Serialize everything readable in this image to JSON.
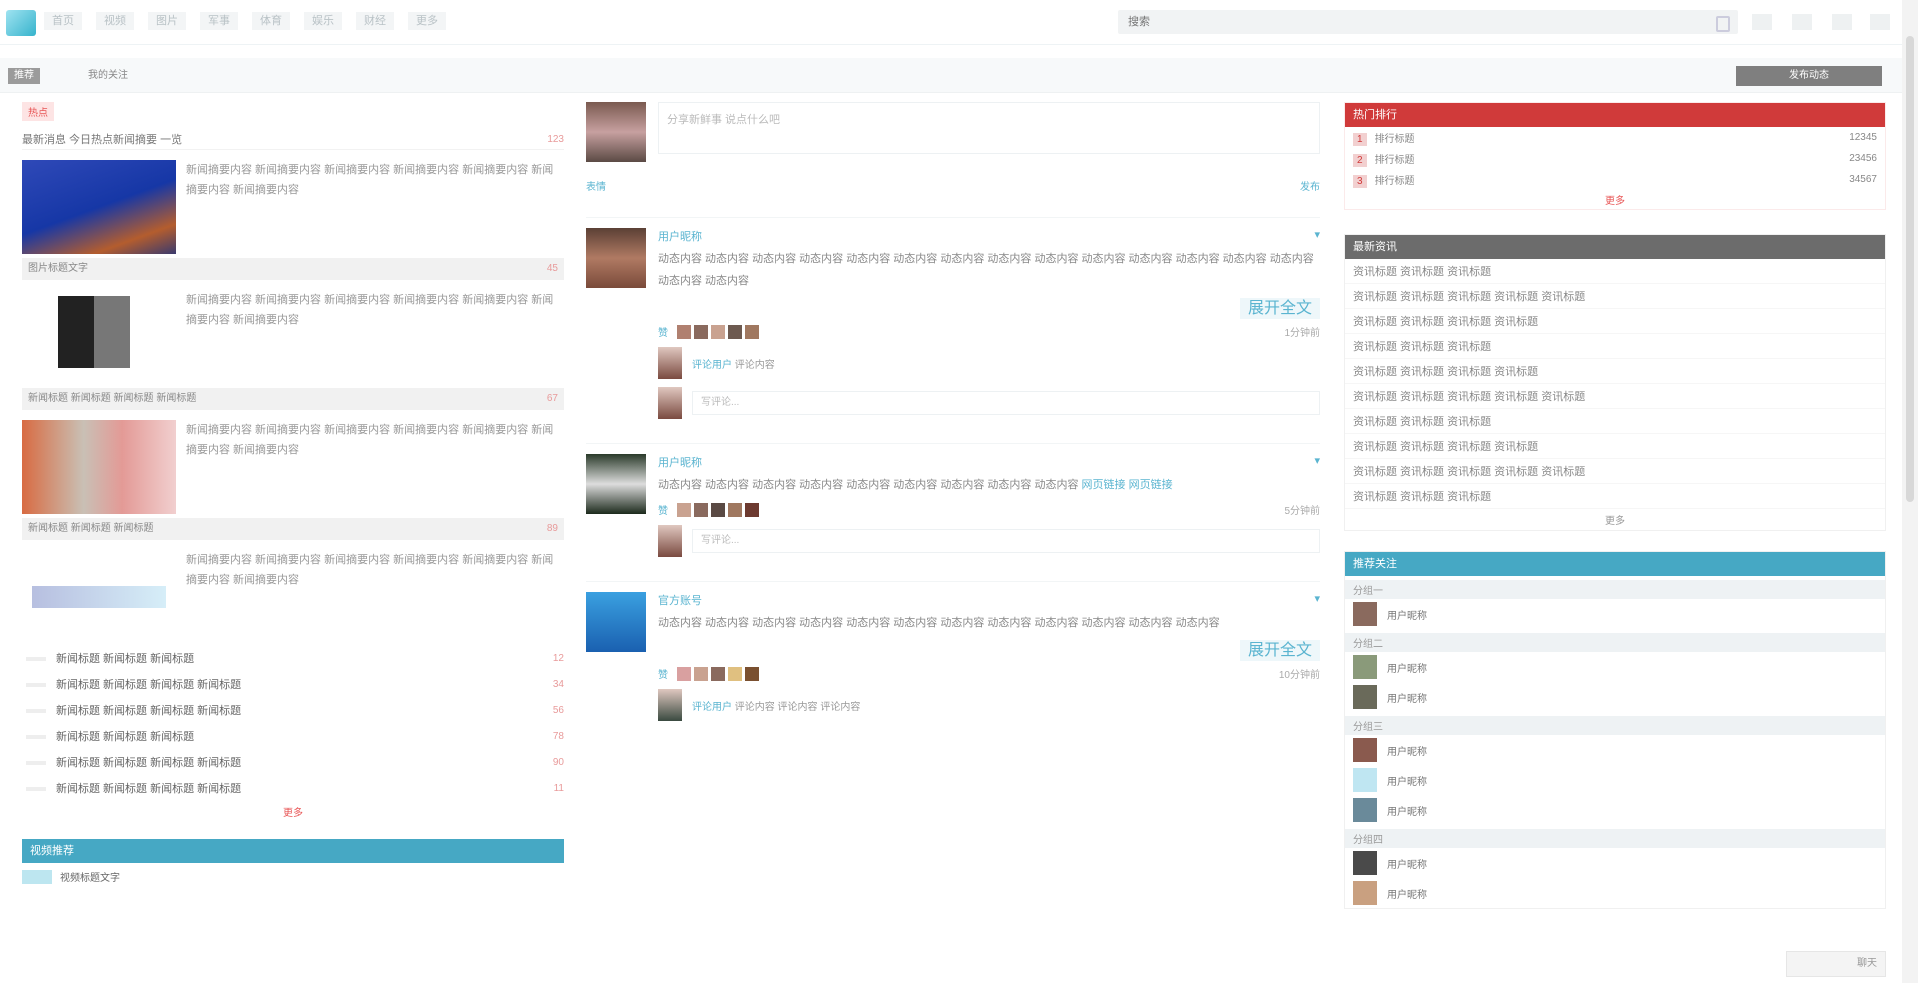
{
  "topbar": {
    "nav": [
      "首页",
      "视频",
      "图片",
      "军事",
      "体育",
      "娱乐",
      "财经",
      "更多"
    ],
    "search_placeholder": "搜索",
    "icons": [
      "home-icon",
      "bell-icon",
      "mail-icon",
      "user-icon"
    ]
  },
  "subbar": {
    "tabs": [
      "推荐",
      "我的关注"
    ],
    "right_button": "发布动态"
  },
  "left": {
    "section_tag": "热点",
    "headline": "最新消息 今日热点新闻摘要 一览",
    "headline_count": "123",
    "blocks": [
      {
        "text": "新闻摘要内容 新闻摘要内容 新闻摘要内容 新闻摘要内容 新闻摘要内容 新闻摘要内容 新闻摘要内容",
        "caption": "图片标题文字",
        "count": "45"
      },
      {
        "text": "新闻摘要内容 新闻摘要内容 新闻摘要内容 新闻摘要内容 新闻摘要内容 新闻摘要内容 新闻摘要内容",
        "caption": "新闻标题 新闻标题 新闻标题 新闻标题",
        "count": "67"
      },
      {
        "text": "新闻摘要内容 新闻摘要内容 新闻摘要内容 新闻摘要内容 新闻摘要内容 新闻摘要内容 新闻摘要内容",
        "caption": "新闻标题 新闻标题 新闻标题",
        "count": "89"
      },
      {
        "text": "新闻摘要内容 新闻摘要内容 新闻摘要内容 新闻摘要内容 新闻摘要内容 新闻摘要内容 新闻摘要内容",
        "caption": "",
        "count": ""
      }
    ],
    "list": [
      {
        "title": "新闻标题 新闻标题 新闻标题",
        "count": "12"
      },
      {
        "title": "新闻标题 新闻标题 新闻标题 新闻标题",
        "count": "34"
      },
      {
        "title": "新闻标题 新闻标题 新闻标题 新闻标题",
        "count": "56"
      },
      {
        "title": "新闻标题 新闻标题 新闻标题",
        "count": "78"
      },
      {
        "title": "新闻标题 新闻标题 新闻标题 新闻标题",
        "count": "90"
      },
      {
        "title": "新闻标题 新闻标题 新闻标题 新闻标题",
        "count": "11"
      }
    ],
    "more": "更多",
    "blue_section": "视频推荐",
    "blue_item": "视频标题文字"
  },
  "mid": {
    "composer_placeholder": "分享新鲜事 说点什么吧",
    "composer_left": "表情",
    "composer_right": "发布",
    "posts": [
      {
        "name": "用户昵称",
        "text": "动态内容 动态内容 动态内容 动态内容 动态内容 动态内容 动态内容 动态内容 动态内容 动态内容 动态内容 动态内容 动态内容 动态内容 动态内容 动态内容",
        "link": "",
        "likes_label": "赞",
        "time": "1分钟前",
        "expand": "展开全文",
        "comment_name": "评论用户",
        "comment_text": "评论内容",
        "comment_placeholder": "写评论..."
      },
      {
        "name": "用户昵称",
        "text": "动态内容 动态内容 动态内容 动态内容 动态内容 动态内容 动态内容 动态内容 动态内容",
        "link": "网页链接 网页链接",
        "likes_label": "赞",
        "time": "5分钟前",
        "expand": "",
        "comment_name": "",
        "comment_text": "",
        "comment_placeholder": "写评论..."
      },
      {
        "name": "官方账号",
        "text": "动态内容 动态内容 动态内容 动态内容 动态内容 动态内容 动态内容 动态内容 动态内容 动态内容 动态内容 动态内容",
        "link": "",
        "likes_label": "赞",
        "time": "10分钟前",
        "expand": "展开全文",
        "comment_name": "评论用户",
        "comment_text": "评论内容 评论内容 评论内容",
        "comment_placeholder": "写评论..."
      }
    ]
  },
  "right": {
    "red_head": "热门排行",
    "red_rows": [
      {
        "rank": "1",
        "title": "排行标题",
        "value": "12345"
      },
      {
        "rank": "2",
        "title": "排行标题",
        "value": "23456"
      },
      {
        "rank": "3",
        "title": "排行标题",
        "value": "34567"
      }
    ],
    "red_more": "更多",
    "gray_head": "最新资讯",
    "gray_rows": [
      "资讯标题 资讯标题 资讯标题",
      "资讯标题 资讯标题 资讯标题 资讯标题 资讯标题",
      "资讯标题 资讯标题 资讯标题 资讯标题",
      "资讯标题 资讯标题 资讯标题",
      "资讯标题 资讯标题 资讯标题 资讯标题",
      "资讯标题 资讯标题 资讯标题 资讯标题 资讯标题",
      "资讯标题 资讯标题 资讯标题",
      "资讯标题 资讯标题 资讯标题 资讯标题",
      "资讯标题 资讯标题 资讯标题 资讯标题 资讯标题",
      "资讯标题 资讯标题 资讯标题"
    ],
    "gray_more": "更多",
    "teal_head": "推荐关注",
    "groups": [
      {
        "name": "分组一",
        "users": [
          "用户昵称"
        ]
      },
      {
        "name": "分组二",
        "users": [
          "用户昵称",
          "用户昵称"
        ]
      },
      {
        "name": "分组三",
        "users": [
          "用户昵称",
          "用户昵称",
          "用户昵称"
        ]
      },
      {
        "name": "分组四",
        "users": [
          "用户昵称",
          "用户昵称"
        ]
      }
    ]
  },
  "chat_button": "聊天"
}
